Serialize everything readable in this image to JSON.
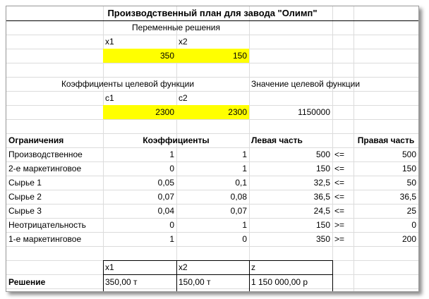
{
  "title": "Производственный план для завода \"Олимп\"",
  "variables": {
    "header": "Переменные решения",
    "x1_label": "x1",
    "x2_label": "x2",
    "x1_value": "350",
    "x2_value": "150"
  },
  "objective": {
    "coef_header": "Коэффициенты целевой функции",
    "value_header": "Значение целевой функции",
    "c1_label": "c1",
    "c2_label": "c2",
    "c1_value": "2300",
    "c2_value": "2300",
    "value": "1150000"
  },
  "constraints": {
    "headers": {
      "name": "Ограничения",
      "coefs": "Коэффициенты",
      "lhs": "Левая часть",
      "rhs": "Правая часть"
    },
    "rows": [
      {
        "name": "Производственное",
        "a1": "1",
        "a2": "1",
        "lhs": "500",
        "sign": "<=",
        "rhs": "500"
      },
      {
        "name": "2-е маркетинговое",
        "a1": "0",
        "a2": "1",
        "lhs": "150",
        "sign": "<=",
        "rhs": "150"
      },
      {
        "name": "Сырье 1",
        "a1": "0,05",
        "a2": "0,1",
        "lhs": "32,5",
        "sign": "<=",
        "rhs": "50"
      },
      {
        "name": "Сырье 2",
        "a1": "0,07",
        "a2": "0,08",
        "lhs": "36,5",
        "sign": "<=",
        "rhs": "36,5"
      },
      {
        "name": "Сырье 3",
        "a1": "0,04",
        "a2": "0,07",
        "lhs": "24,5",
        "sign": "<=",
        "rhs": "25"
      },
      {
        "name": "Неотрицательность",
        "a1": "0",
        "a2": "1",
        "lhs": "150",
        "sign": ">=",
        "rhs": "0"
      },
      {
        "name": "1-е маркетинговое",
        "a1": "1",
        "a2": "0",
        "lhs": "350",
        "sign": ">=",
        "rhs": "200"
      }
    ]
  },
  "solution": {
    "label": "Решение",
    "x1_label": "x1",
    "x2_label": "x2",
    "z_label": "z",
    "x1": "350,00 т",
    "x2": "150,00 т",
    "z": "1 150 000,00 р"
  },
  "colors": {
    "highlight": "#ffff00",
    "gridline": "#dcdcdc"
  }
}
